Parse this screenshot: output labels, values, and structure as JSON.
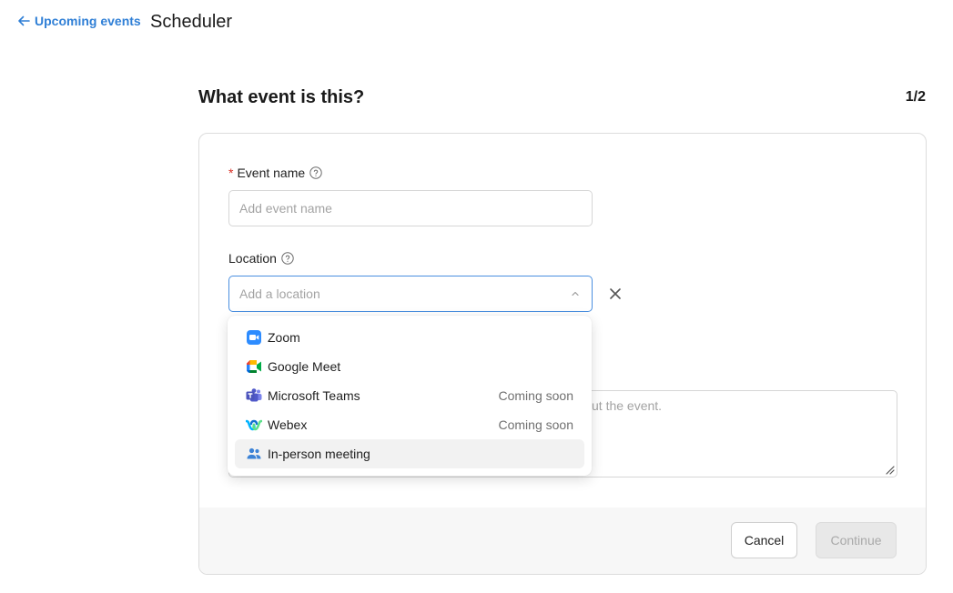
{
  "header": {
    "back_label": "Upcoming events",
    "title": "Scheduler"
  },
  "page": {
    "heading": "What event is this?",
    "step": "1/2"
  },
  "form": {
    "event_name": {
      "required_mark": "*",
      "label": "Event name",
      "placeholder": "Add event name",
      "value": ""
    },
    "location": {
      "label": "Location",
      "placeholder": "Add a location",
      "value": ""
    },
    "description": {
      "visible_placeholder_fragment": "ut the event."
    }
  },
  "location_options": [
    {
      "label": "Zoom",
      "icon": "zoom-icon",
      "note": ""
    },
    {
      "label": "Google Meet",
      "icon": "google-meet-icon",
      "note": ""
    },
    {
      "label": "Microsoft Teams",
      "icon": "microsoft-teams-icon",
      "note": "Coming soon"
    },
    {
      "label": "Webex",
      "icon": "webex-icon",
      "note": "Coming soon"
    },
    {
      "label": "In-person meeting",
      "icon": "people-icon",
      "note": ""
    }
  ],
  "actions": {
    "cancel_label": "Cancel",
    "continue_label": "Continue"
  },
  "colors": {
    "link": "#2f7fd6",
    "focus_border": "#4a8fe0",
    "required": "#d93025"
  }
}
